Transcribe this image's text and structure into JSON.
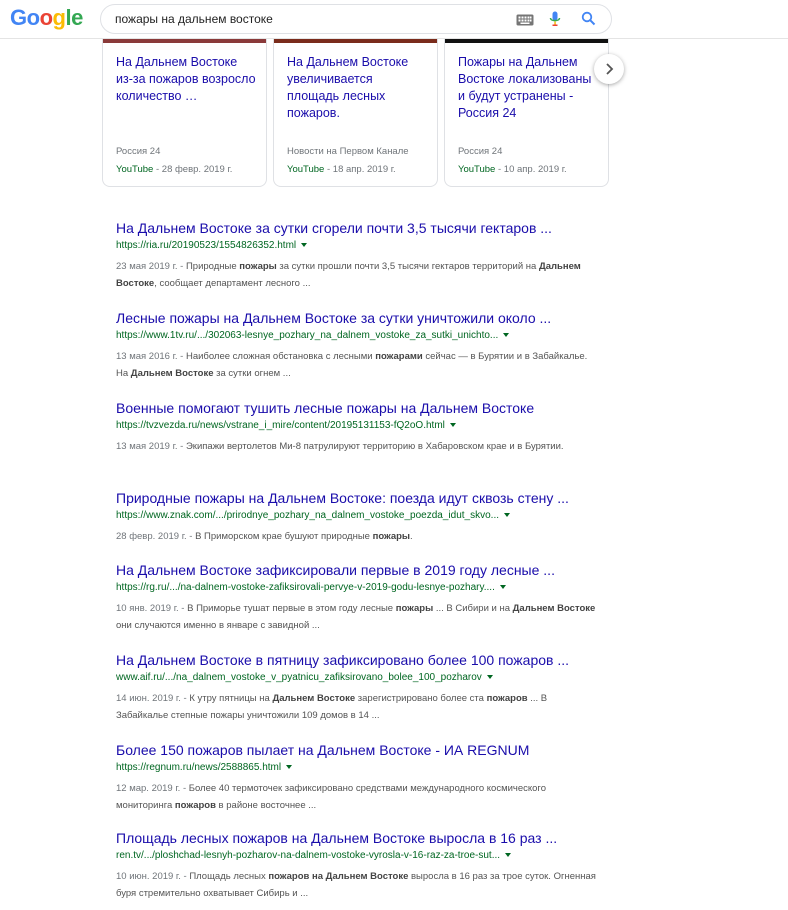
{
  "header": {
    "logo": [
      "Go",
      "o",
      "g",
      "le"
    ],
    "search_value": "пожары на дальнем востоке",
    "icons": [
      "keyboard-icon",
      "mic-icon",
      "search-icon"
    ]
  },
  "cards": [
    {
      "title": "На Дальнем Востоке из-за пожаров возросло количество …",
      "source": "Россия 24",
      "channel": "YouTube",
      "date": " - 28 февр. 2019 г."
    },
    {
      "title": "На Дальнем Востоке увеличивается площадь лесных пожаров.",
      "source": "Новости на Первом Канале",
      "channel": "YouTube",
      "date": " - 18 апр. 2019 г."
    },
    {
      "title": "Пожары на Дальнем Востоке локализованы и будут устранены - Россия 24",
      "source": "Россия 24",
      "channel": "YouTube",
      "date": " - 10 апр. 2019 г."
    }
  ],
  "results": [
    {
      "title": "На Дальнем Востоке за сутки сгорели почти 3,5 тысячи гектаров ...",
      "url": "https://ria.ru/20190523/1554826352.html",
      "date": "23 мая 2019 г. - ",
      "snippet": [
        "Природные ",
        "пожары",
        " за сутки прошли почти 3,5 тысячи гектаров территорий на ",
        "Дальнем Востоке",
        ", сообщает департамент лесного ..."
      ]
    },
    {
      "title": "Лесные пожары на Дальнем Востоке за сутки уничтожили около ...",
      "url": "https://www.1tv.ru/.../302063-lesnye_pozhary_na_dalnem_vostoke_za_sutki_unichto...",
      "date": "13 мая 2016 г. - ",
      "snippet": [
        "Наиболее сложная обстановка с лесными ",
        "пожарами",
        " сейчас — в Бурятии и в Забайкалье. На ",
        "Дальнем Востоке",
        " за сутки огнем ..."
      ]
    },
    {
      "title": "Военные помогают тушить лесные пожары на Дальнем Востоке",
      "url": "https://tvzvezda.ru/news/vstrane_i_mire/content/20195131153-fQ2oO.html",
      "date": "13 мая 2019 г. - ",
      "snippet": [
        "Экипажи вертолетов Ми-8 патрулируют территорию в Хабаровском крае и в Бурятии.",
        "",
        "",
        "",
        ""
      ]
    },
    {
      "title": "Природные пожары на Дальнем Востоке: поезда идут сквозь стену ...",
      "url": "https://www.znak.com/.../prirodnye_pozhary_na_dalnem_vostoke_poezda_idut_skvo...",
      "date": "28 февр. 2019 г. - ",
      "snippet": [
        "В Приморском крае бушуют природные ",
        "пожары",
        ".",
        "",
        ""
      ]
    },
    {
      "title": "На Дальнем Востоке зафиксировали первые в 2019 году лесные ...",
      "url": "https://rg.ru/.../na-dalnem-vostoke-zafiksirovali-pervye-v-2019-godu-lesnye-pozhary....",
      "date": "10 янв. 2019 г. - ",
      "snippet": [
        "В Приморье тушат первые в этом году лесные ",
        "пожары",
        " ... В Сибири и на ",
        "Дальнем Востоке",
        " они случаются именно в январе с завидной ..."
      ]
    },
    {
      "title": "На Дальнем Востоке в пятницу зафиксировано более 100 пожаров ...",
      "url": "www.aif.ru/.../na_dalnem_vostoke_v_pyatnicu_zafiksirovano_bolee_100_pozharov",
      "date": "14 июн. 2019 г. - ",
      "snippet": [
        "К утру пятницы на ",
        "Дальнем Востоке",
        " зарегистрировано более ста ",
        "пожаров",
        " ... В Забайкалье степные пожары уничтожили 109 домов в 14 ..."
      ]
    },
    {
      "title": "Более 150 пожаров пылает на Дальнем Востоке - ИА REGNUM",
      "url": "https://regnum.ru/news/2588865.html",
      "date": "12 мар. 2019 г. - ",
      "snippet": [
        "Более 40 термоточек зафиксировано средствами международного космического мониторинга ",
        "пожаров",
        " в районе восточнее ...",
        "",
        ""
      ]
    },
    {
      "title": "Площадь лесных пожаров на Дальнем Востоке выросла в 16 раз ...",
      "url": "ren.tv/.../ploshchad-lesnyh-pozharov-na-dalnem-vostoke-vyrosla-v-16-raz-za-troe-sut...",
      "date": "10 июн. 2019 г. - ",
      "snippet": [
        "Площадь лесных ",
        "пожаров на Дальнем Востоке",
        " выросла в 16 раз за трое суток. Огненная буря стремительно охватывает Сибирь и ...",
        "",
        ""
      ]
    }
  ]
}
